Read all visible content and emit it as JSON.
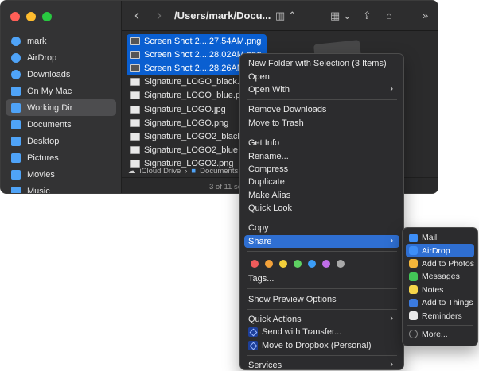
{
  "window": {
    "path_title": "/Users/mark/Docu...",
    "status_text": "3 of 11 se",
    "preview_label": "iCloud Drive"
  },
  "sidebar": {
    "items": [
      {
        "label": "mark",
        "icon": "home-icon",
        "color": "#4fa3f7"
      },
      {
        "label": "AirDrop",
        "icon": "airdrop-icon",
        "color": "#4fa3f7"
      },
      {
        "label": "Downloads",
        "icon": "downloads-icon",
        "color": "#4fa3f7"
      },
      {
        "label": "On My Mac",
        "icon": "folder-icon",
        "color": "#4fa3f7"
      },
      {
        "label": "Working Dir",
        "icon": "folder-icon",
        "color": "#4fa3f7"
      },
      {
        "label": "Documents",
        "icon": "documents-icon",
        "color": "#4fa3f7"
      },
      {
        "label": "Desktop",
        "icon": "desktop-icon",
        "color": "#4fa3f7"
      },
      {
        "label": "Pictures",
        "icon": "pictures-icon",
        "color": "#4fa3f7"
      },
      {
        "label": "Movies",
        "icon": "movies-icon",
        "color": "#4fa3f7"
      },
      {
        "label": "Music",
        "icon": "music-icon",
        "color": "#4fa3f7"
      }
    ],
    "selected_index": 4
  },
  "files": [
    {
      "name": "Screen Shot 2....27.54AM.png",
      "selected": true
    },
    {
      "name": "Screen Shot 2....28.02AM.png",
      "selected": true
    },
    {
      "name": "Screen Shot 2....28.26AM.png",
      "selected": true
    },
    {
      "name": "Signature_LOGO_black.png",
      "selected": false
    },
    {
      "name": "Signature_LOGO_blue.png",
      "selected": false
    },
    {
      "name": "Signature_LOGO.jpg",
      "selected": false
    },
    {
      "name": "Signature_LOGO.png",
      "selected": false
    },
    {
      "name": "Signature_LOGO2_black.png",
      "selected": false
    },
    {
      "name": "Signature_LOGO2_blue.png",
      "selected": false
    },
    {
      "name": "Signature_LOGO2.png",
      "selected": false
    }
  ],
  "pathbar": {
    "root": "iCloud Drive",
    "sep": "›",
    "folder": "Documents"
  },
  "menu": {
    "new_folder": "New Folder with Selection (3 Items)",
    "open": "Open",
    "open_with": "Open With",
    "remove_downloads": "Remove Downloads",
    "move_to_trash": "Move to Trash",
    "get_info": "Get Info",
    "rename": "Rename...",
    "compress": "Compress",
    "duplicate": "Duplicate",
    "make_alias": "Make Alias",
    "quick_look": "Quick Look",
    "copy": "Copy",
    "share": "Share",
    "tags": "Tags...",
    "show_preview_options": "Show Preview Options",
    "quick_actions": "Quick Actions",
    "send_with_transfer": "Send with Transfer...",
    "move_to_dropbox": "Move to Dropbox (Personal)",
    "services": "Services",
    "arrow": "›"
  },
  "tag_colors": [
    "#ee5b5b",
    "#f3a23a",
    "#f2cf3a",
    "#5ed062",
    "#3b9df7",
    "#c06ee8",
    "#a9a9a9"
  ],
  "share_menu": {
    "items": [
      {
        "label": "Mail",
        "icon": "mail-icon",
        "color": "#3d8ef7"
      },
      {
        "label": "AirDrop",
        "icon": "airdrop-icon",
        "color": "#3d8ef7"
      },
      {
        "label": "Add to Photos",
        "icon": "photos-icon",
        "color": "#f4b63a"
      },
      {
        "label": "Messages",
        "icon": "messages-icon",
        "color": "#43c657"
      },
      {
        "label": "Notes",
        "icon": "notes-icon",
        "color": "#f5d54a"
      },
      {
        "label": "Add to Things",
        "icon": "things-icon",
        "color": "#3b7be0"
      },
      {
        "label": "Reminders",
        "icon": "reminders-icon",
        "color": "#e9e9e9"
      },
      {
        "label": "More...",
        "icon": "more-icon",
        "color": "#8a8a8a"
      }
    ],
    "highlighted_index": 1
  },
  "colors": {
    "accent": "#2f6fd2",
    "selection": "#0a5fd1"
  }
}
